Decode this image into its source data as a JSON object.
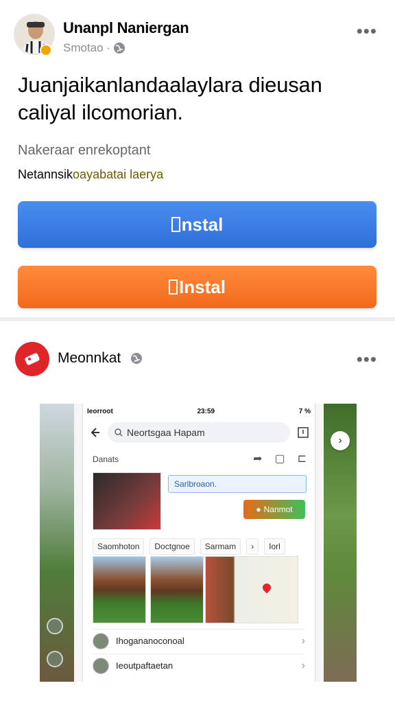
{
  "post1": {
    "author": "Unanpl Naniergan",
    "subtitle": "Smotao ·",
    "text": "Juanjaikanlandaalaylara dieusan caliyal ilcomorian.",
    "meta_line1": "Nakeraar enrekoptant",
    "meta_line2_a": "Netannsik",
    "meta_line2_b": "oayabatai laerya",
    "buttons": {
      "blue_label": "nstal",
      "orange_label": "Instal"
    },
    "colors": {
      "blue": "#3a7ee6",
      "orange": "#f5792a",
      "badge": "#f0a500"
    }
  },
  "post2": {
    "author": "Meonnkat",
    "screenshot": {
      "status_left": "Ieorroot",
      "status_time": "23:59",
      "status_right": "7 %",
      "search_placeholder": "Neortsgaa Hapam",
      "section_title": "Danats",
      "card_input": "Sarlbroaon.",
      "card_button": "Nanmot",
      "tabs": [
        "Saomhoton",
        "Doctgnoe",
        "Sarmam",
        "›",
        "Iorl"
      ],
      "rows": [
        "Ihogananoconoal",
        "Ieoutpaftaetan"
      ]
    }
  },
  "icons": [
    "globe-icon",
    "more-icon",
    "back-arrow-icon",
    "search-icon",
    "share-icon",
    "chevron-right-icon",
    "wifi-icon",
    "battery-icon"
  ]
}
